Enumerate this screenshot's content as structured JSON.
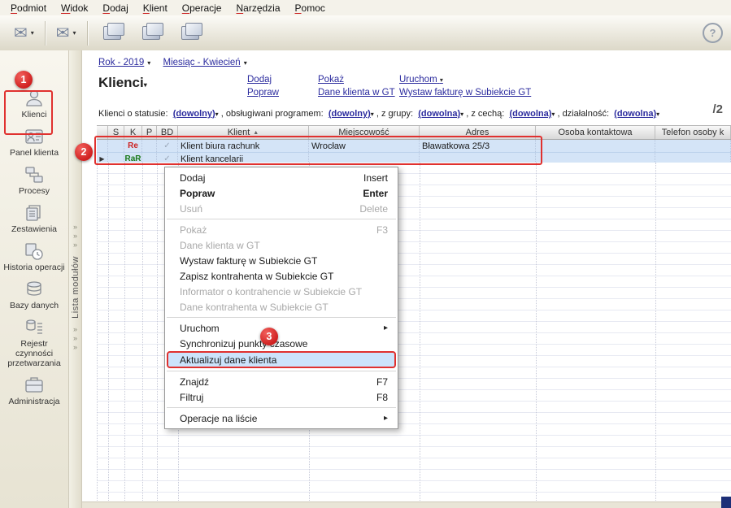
{
  "menubar": {
    "items": [
      "Podmiot",
      "Widok",
      "Dodaj",
      "Klient",
      "Operacje",
      "Narzędzia",
      "Pomoc"
    ]
  },
  "icons": {
    "envelope": "✉",
    "dropdown": "▾",
    "submenu": "▸",
    "chevron": "»",
    "help": "?",
    "current_row": "▶",
    "sort_asc": "▲"
  },
  "sidebar": {
    "panel_title": "Lista modułów",
    "items": [
      {
        "label": "Klienci"
      },
      {
        "label": "Panel klienta"
      },
      {
        "label": "Procesy"
      },
      {
        "label": "Zestawienia"
      },
      {
        "label": "Historia operacji"
      },
      {
        "label": "Bazy danych"
      },
      {
        "label": "Rejestr czynności przetwarzania"
      },
      {
        "label": "Administracja"
      }
    ]
  },
  "breadcrumb": {
    "year": "Rok - 2019",
    "month": "Miesiąc - Kwiecień"
  },
  "header": {
    "title": "Klienci",
    "actions": [
      "Dodaj",
      "Popraw",
      "Pokaż",
      "Dane klienta w GT",
      "Uruchom",
      "Wystaw fakturę w Subiekcie GT"
    ]
  },
  "filters": {
    "segments": [
      {
        "label": "Klienci o statusie:",
        "value": "(dowolny)"
      },
      {
        "label": ", obsługiwani programem:",
        "value": "(dowolny)"
      },
      {
        "label": ", z grupy:",
        "value": "(dowolna)"
      },
      {
        "label": ", z cechą:",
        "value": "(dowolna)"
      },
      {
        "label": ", działalność:",
        "value": "(dowolna)"
      }
    ],
    "record_count": "/2"
  },
  "table": {
    "columns": [
      "S",
      "K",
      "P",
      "BD",
      "Klient",
      "Miejscowość",
      "Adres",
      "Osoba kontaktowa",
      "Telefon osoby k"
    ],
    "rows": [
      {
        "s": "",
        "k": "Re",
        "k_color": "#cc2222",
        "p": "",
        "bd": "✓",
        "klient": "Klient biura rachunk",
        "miejscowosc": "Wrocław",
        "adres": "Bławatkowa 25/3",
        "osoba_kontaktowa": "",
        "telefon": ""
      },
      {
        "s": "",
        "k": "RaR",
        "k_color": "#1a7a1a",
        "p": "",
        "bd": "✓",
        "klient": "Klient kancelarii",
        "miejscowosc": "",
        "adres": "",
        "osoba_kontaktowa": "",
        "telefon": ""
      }
    ]
  },
  "context_menu": {
    "items": [
      {
        "label": "Dodaj",
        "shortcut": "Insert",
        "enabled": true
      },
      {
        "label": "Popraw",
        "shortcut": "Enter",
        "enabled": true,
        "bold": true
      },
      {
        "label": "Usuń",
        "shortcut": "Delete",
        "enabled": false
      },
      {
        "type": "separator"
      },
      {
        "label": "Pokaż",
        "shortcut": "F3",
        "enabled": false
      },
      {
        "label": "Dane klienta w GT",
        "enabled": false
      },
      {
        "label": "Wystaw fakturę w Subiekcie GT",
        "enabled": true
      },
      {
        "label": "Zapisz kontrahenta w Subiekcie GT",
        "enabled": true
      },
      {
        "label": "Informator o kontrahencie w Subiekcie GT",
        "enabled": false
      },
      {
        "label": "Dane kontrahenta w Subiekcie GT",
        "enabled": false
      },
      {
        "type": "separator"
      },
      {
        "label": "Uruchom",
        "submenu": true,
        "enabled": true
      },
      {
        "label": "Synchronizuj punkty czasowe",
        "enabled": true
      },
      {
        "label": "Aktualizuj dane klienta",
        "enabled": true,
        "highlighted": true
      },
      {
        "type": "separator"
      },
      {
        "label": "Znajdź",
        "shortcut": "F7",
        "enabled": true
      },
      {
        "label": "Filtruj",
        "shortcut": "F8",
        "enabled": true
      },
      {
        "type": "separator"
      },
      {
        "label": "Operacje na liście",
        "submenu": true,
        "enabled": true
      }
    ]
  },
  "annotations": {
    "steps": [
      "1",
      "2",
      "3"
    ],
    "accent_color": "#e0312f"
  },
  "colors": {
    "selection": "#d4e4f7",
    "link": "#2b2b9e",
    "toolbar": "#dcd8c8"
  }
}
